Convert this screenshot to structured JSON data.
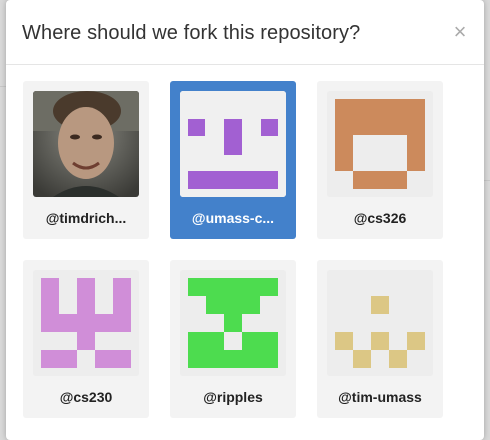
{
  "dialog": {
    "title": "Where should we fork this repository?",
    "close_glyph": "×"
  },
  "accounts": [
    {
      "label": "@timdrich...",
      "avatar": "photo-avatar",
      "selected": false
    },
    {
      "label": "@umass-c...",
      "avatar": "identicon-purple-face",
      "color": "#a260d2",
      "selected": true
    },
    {
      "label": "@cs326",
      "avatar": "identicon-orange",
      "color": "#cc8a5c",
      "selected": false
    },
    {
      "label": "@cs230",
      "avatar": "identicon-pink",
      "color": "#d08ed8",
      "selected": false
    },
    {
      "label": "@ripples",
      "avatar": "identicon-green",
      "color": "#4ddc4f",
      "selected": false
    },
    {
      "label": "@tim-umass",
      "avatar": "identicon-tan",
      "color": "#dcc785",
      "selected": false
    }
  ],
  "colors": {
    "selected_card": "#4381cb",
    "card_background": "#f3f3f3"
  }
}
